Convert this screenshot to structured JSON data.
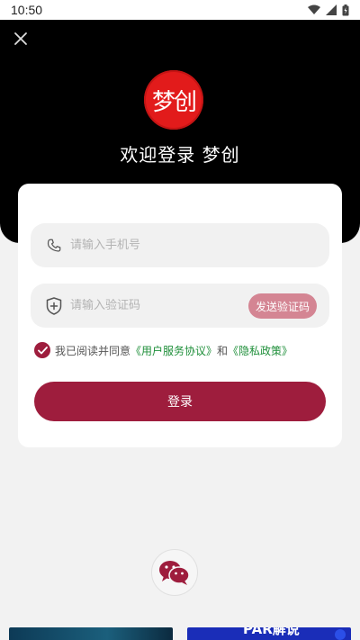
{
  "status_bar": {
    "time": "10:50",
    "icons": [
      "wifi-icon",
      "cell-signal-icon",
      "battery-icon"
    ]
  },
  "header": {
    "logo_text": "梦创",
    "welcome_text": "欢迎登录 梦创"
  },
  "form": {
    "phone_placeholder": "请输入手机号",
    "code_placeholder": "请输入验证码",
    "send_code_label": "发送验证码",
    "agreement_prefix": "我已阅读并同意",
    "user_agreement": "《用户服务协议》",
    "agreement_and": "和",
    "privacy_policy": "《隐私政策》",
    "agreement_checked": true,
    "login_label": "登录"
  },
  "bottom_banner": {
    "right_text": "PAR解说"
  },
  "colors": {
    "primary": "#9e1d3d",
    "send_code_bg": "#d48593",
    "link": "#1f8f3a",
    "logo_red": "#e21b1b"
  }
}
